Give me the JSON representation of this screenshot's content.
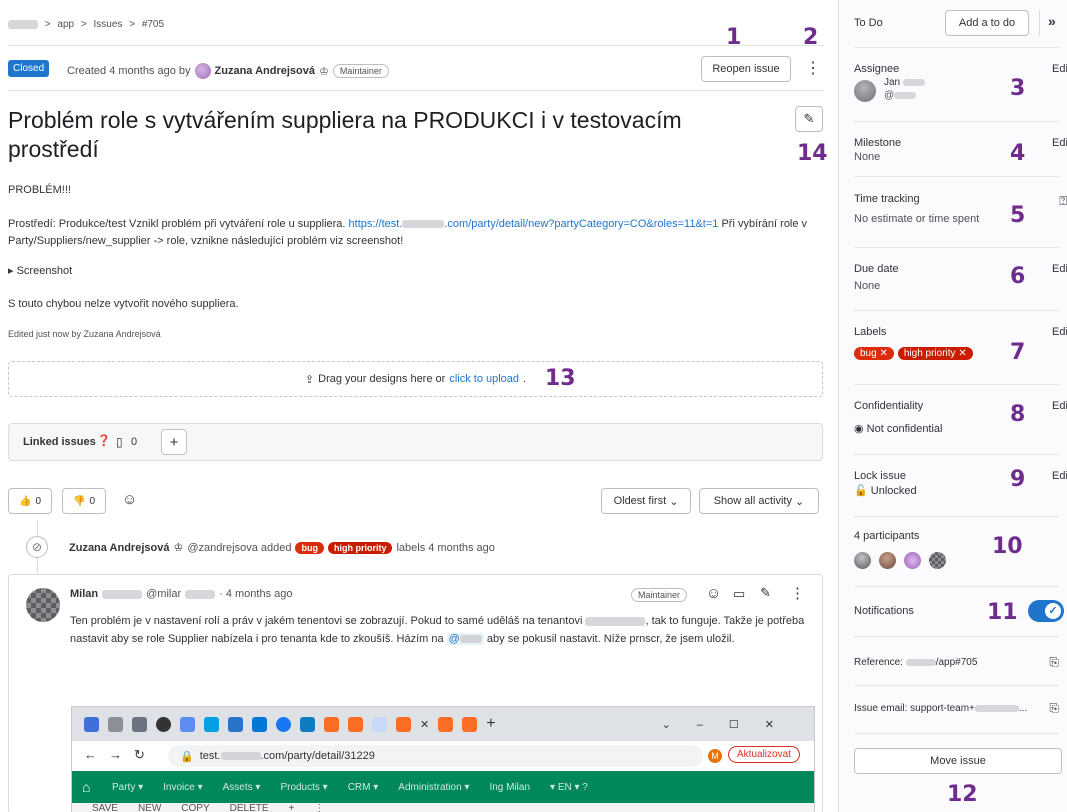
{
  "breadcrumb": {
    "sep": ">",
    "items": [
      "app",
      "Issues",
      "#705"
    ]
  },
  "issue": {
    "status": "Closed",
    "created_prefix": "Created 4 months ago by",
    "author": "Zuzana Andrejsová",
    "author_role": "Maintainer",
    "reopen_label": "Reopen issue",
    "title": "Problém role s vytvářením suppliera na PRODUKCI i v testovacím prostředí",
    "body_heading": "PROBLÉM!!!",
    "body_line1_prefix": "Prostředí: Produkce/test Vznikl problém při vytváření role u suppliera.",
    "body_link_a": "https://test.",
    "body_link_b": ".com/party/detail/new?partyCategory=CO&roles=11&t=1",
    "body_line1_suffix": "Při",
    "body_line2": "vybírání role v Party/Suppliers/new_supplier -> role, vznikne následující problém viz screenshot!",
    "details_label": "Screenshot",
    "body_line3": "S touto chybou nelze vytvořit nového suppliera.",
    "edited": "Edited just now by Zuzana Andrejsová"
  },
  "designs": {
    "prefix": "Drag your designs here or",
    "link": "click to upload",
    "suffix": "."
  },
  "linked": {
    "label": "Linked issues",
    "count": "0",
    "add": "+"
  },
  "reactions": {
    "up": "0",
    "down": "0"
  },
  "sort": {
    "order": "Oldest first",
    "filter": "Show all activity"
  },
  "system_note": {
    "author": "Zuzana Andrejsová",
    "handle": "@zandrejsova added",
    "label_bug": "bug",
    "label_hp": "high priority",
    "suffix": "labels 4 months ago"
  },
  "comment": {
    "author": "Milan",
    "handle": "@milar",
    "time": "· 4 months ago",
    "role": "Maintainer",
    "line1_a": "Ten problém je v nastavení rolí a práv v jakém tenentovi se zobrazují. Pokud to samé uděláš na tenantovi",
    "line1_b": ", tak to funguje. Takže je",
    "line2_a": "potřeba nastavit aby se role Supplier nabízela i pro tenanta kde to zkoušíš. Házím na",
    "mention": "@",
    "line2_b": "aby se pokusil nastavit. Níže prnscr, že jsem",
    "line3": "uložil."
  },
  "embedded": {
    "url_prefix": "test.",
    "url_suffix": ".com/party/detail/31229",
    "update_btn": "Aktualizovat",
    "avatar_letter": "M",
    "nav": [
      "Party ▾",
      "Invoice ▾",
      "Assets ▾",
      "Products ▾",
      "CRM ▾",
      "Administration ▾",
      "Ing Milan",
      "▾  EN ▾  ?"
    ],
    "toolbar": [
      "SAVE",
      "NEW",
      "COPY",
      "DELETE",
      "+",
      "⋮"
    ]
  },
  "sidebar": {
    "todo_label": "To Do",
    "todo_button": "Add a to do",
    "assignee": {
      "heading": "Assignee",
      "name": "Jan",
      "handle": "@"
    },
    "milestone": {
      "heading": "Milestone",
      "value": "None"
    },
    "time": {
      "heading": "Time tracking",
      "value": "No estimate or time spent"
    },
    "due": {
      "heading": "Due date",
      "value": "None"
    },
    "labels": {
      "heading": "Labels",
      "bug": "bug",
      "hp": "high priority"
    },
    "confidentiality": {
      "heading": "Confidentiality",
      "value": "Not confidential"
    },
    "lock": {
      "heading": "Lock issue",
      "value": "Unlocked"
    },
    "participants": {
      "heading": "4 participants"
    },
    "notifications": {
      "heading": "Notifications",
      "on": true
    },
    "reference": {
      "prefix": "Reference:",
      "suffix": "/app#705"
    },
    "email": {
      "prefix": "Issue email: support-team+",
      "suffix": "..."
    },
    "move": "Move issue",
    "edit": "Edit"
  },
  "annotations": [
    "1",
    "2",
    "3",
    "4",
    "5",
    "6",
    "7",
    "8",
    "9",
    "10",
    "11",
    "12",
    "13",
    "14"
  ],
  "colors": {
    "primary": "#1f75cb",
    "danger": "#dd2b0e",
    "annotation": "#6e2c8c",
    "embedded_nav": "#00875a"
  }
}
